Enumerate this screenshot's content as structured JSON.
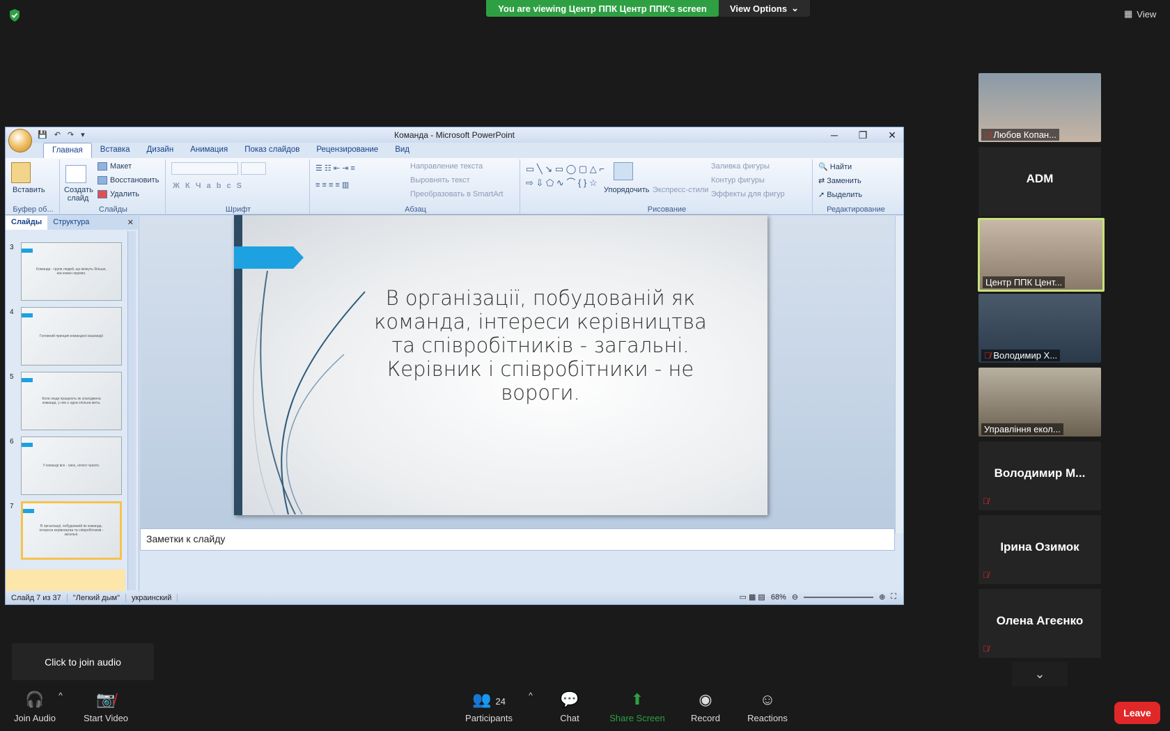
{
  "zoom": {
    "share_banner": "You are viewing Центр ППК Центр ППК's screen",
    "view_options": "View Options",
    "view_label": "View",
    "audio_tip": "Click to join audio",
    "toolbar": {
      "join_audio": "Join Audio",
      "start_video": "Start Video",
      "participants": "Participants",
      "participants_count": "24",
      "chat": "Chat",
      "share_screen": "Share Screen",
      "record": "Record",
      "reactions": "Reactions",
      "leave": "Leave"
    },
    "participants": [
      {
        "name": "Любов Копан...",
        "video": true
      },
      {
        "name": "ADM",
        "video": false
      },
      {
        "name": "Центр ППК Цент...",
        "video": true
      },
      {
        "name": "Володимир Х...",
        "video": true
      },
      {
        "name": "Управління екол...",
        "video": true
      },
      {
        "name": "Володимир М...",
        "video": false
      },
      {
        "name": "Ірина Озимок",
        "video": false
      },
      {
        "name": "Олена Агеєнко",
        "video": false
      }
    ]
  },
  "ppt": {
    "title": "Команда - Microsoft PowerPoint",
    "tabs": [
      "Главная",
      "Вставка",
      "Дизайн",
      "Анимация",
      "Показ слайдов",
      "Рецензирование",
      "Вид"
    ],
    "ribbon": {
      "paste": "Вставить",
      "clipboard": "Буфер об...",
      "create_slide": "Создать слайд",
      "layout": "Макет",
      "restore": "Восстановить",
      "delete": "Удалить",
      "slides_group": "Слайды",
      "font_group": "Шрифт",
      "paragraph_group": "Абзац",
      "text_direction": "Направление текста",
      "align_text": "Выровнять текст",
      "smartart": "Преобразовать в SmartArt",
      "arrange": "Упорядочить",
      "quick_styles": "Экспресс-стили",
      "shape_fill": "Заливка фигуры",
      "shape_outline": "Контур фигуры",
      "shape_effects": "Эффекты для фигур",
      "drawing_group": "Рисование",
      "find": "Найти",
      "replace": "Заменить",
      "select": "Выделить",
      "editing_group": "Редактирование"
    },
    "panel_tabs": [
      "Слайды",
      "Структура"
    ],
    "thumbnails": [
      {
        "num": "3",
        "text": "Команда - група людей, що можуть більше, ніж кожен окремо."
      },
      {
        "num": "4",
        "text": "Головний принцип командної взаємодії"
      },
      {
        "num": "5",
        "text": "Коли люди працюють як злагоджена команда, у них є одна спільна мета."
      },
      {
        "num": "6",
        "text": "У команді все - своє, нічого чужого."
      },
      {
        "num": "7",
        "text": "В організації, побудованій як команда, інтереси керівництва та співробітників - загальні."
      }
    ],
    "slide_text": "В організації, побудованій як команда, інтереси керівництва та співробітників - загальні. Керівник і співробітники - не вороги.",
    "notes": "Заметки к слайду",
    "status": {
      "slide": "Слайд 7 из 37",
      "theme": "\"Легкий дым\"",
      "language": "украинский",
      "zoom": "68%"
    }
  },
  "colors": {
    "banner_green": "#2ea043",
    "leave_red": "#e02828",
    "slide_accent": "#1da1e0",
    "active_speaker": "#c6e27b"
  }
}
